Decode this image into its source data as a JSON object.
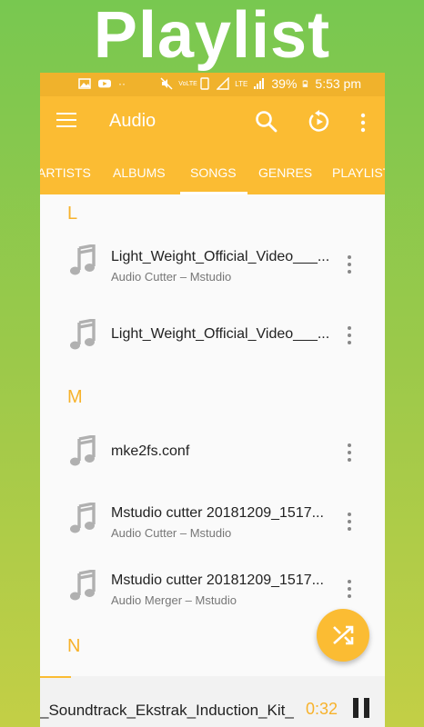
{
  "promo": {
    "title": "Playlist"
  },
  "status_bar": {
    "battery": "39%",
    "time": "5:53 pm",
    "network": "LTE",
    "volte": "VoLTE"
  },
  "app_bar": {
    "title": "Audio",
    "icons": [
      "menu-icon",
      "search-icon",
      "replay-icon",
      "more-vert-icon"
    ]
  },
  "tabs": [
    {
      "label": "ARTISTS",
      "selected": false
    },
    {
      "label": "ALBUMS",
      "selected": false
    },
    {
      "label": "SONGS",
      "selected": true
    },
    {
      "label": "GENRES",
      "selected": false
    },
    {
      "label": "PLAYLISTS",
      "selected": false
    }
  ],
  "sections": [
    {
      "letter": "L",
      "songs": [
        {
          "title": "Light_Weight_Official_Video___...",
          "subtitle": "Audio Cutter – Mstudio"
        },
        {
          "title": "Light_Weight_Official_Video___...",
          "subtitle": ""
        }
      ]
    },
    {
      "letter": "M",
      "songs": [
        {
          "title": "mke2fs.conf",
          "subtitle": ""
        },
        {
          "title": "Mstudio cutter 20181209_1517...",
          "subtitle": "Audio Cutter – Mstudio"
        },
        {
          "title": "Mstudio cutter 20181209_1517...",
          "subtitle": "Audio Merger – Mstudio"
        }
      ]
    },
    {
      "letter": "N",
      "songs": []
    }
  ],
  "mini_player": {
    "title": "_Soundtrack_Ekstrak_Induction_Kit_",
    "time": "0:32"
  },
  "colors": {
    "accent": "#fbbc33",
    "accent_text": "#f7b22b",
    "background_top": "#78c850",
    "background_bottom": "#c3cf46"
  }
}
